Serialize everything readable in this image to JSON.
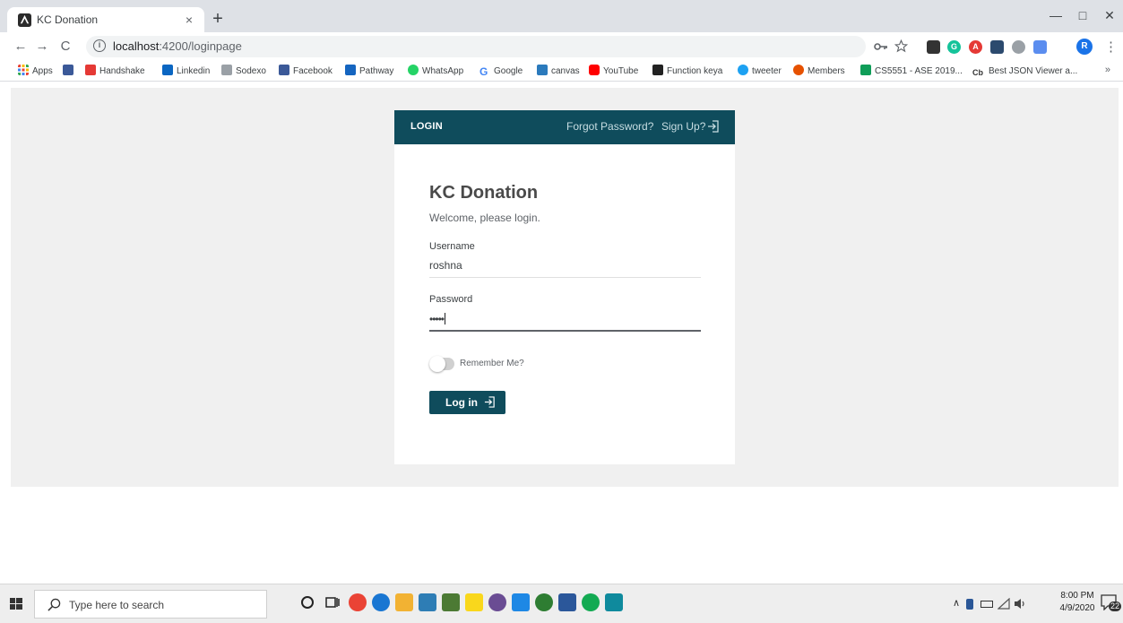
{
  "browser": {
    "tab_title": "KC Donation",
    "tab_close": "×",
    "new_tab": "+",
    "window_controls": {
      "minimize": "—",
      "maximize": "□",
      "close": "✕"
    },
    "nav": {
      "back": "←",
      "forward": "→",
      "reload": "C"
    },
    "url": {
      "host": "localhost",
      "path": ":4200/loginpage"
    },
    "avatar_letter": "R",
    "menu": "⋮"
  },
  "bookmarks": {
    "items": [
      {
        "label": "Apps",
        "color": "#4285f4"
      },
      {
        "label": "",
        "color": "#3b5998"
      },
      {
        "label": "Handshake",
        "color": "#e53935"
      },
      {
        "label": "Linkedin",
        "color": "#0a66c2"
      },
      {
        "label": "Sodexo",
        "color": "#9aa0a6"
      },
      {
        "label": "Facebook",
        "color": "#3b5998"
      },
      {
        "label": "Pathway",
        "color": "#1565c0"
      },
      {
        "label": "WhatsApp",
        "color": "#25d366"
      },
      {
        "label": "Google",
        "color": "#4285f4"
      },
      {
        "label": "canvas",
        "color": "#2b7abc"
      },
      {
        "label": "YouTube",
        "color": "#ff0000"
      },
      {
        "label": "Function keya",
        "color": "#222222"
      },
      {
        "label": "tweeter",
        "color": "#1da1f2"
      },
      {
        "label": "Members",
        "color": "#e65100"
      },
      {
        "label": "CS5551 - ASE 2019...",
        "color": "#0f9d58"
      },
      {
        "label": "Best JSON Viewer a...",
        "color": "#333333"
      }
    ],
    "more": "»"
  },
  "login": {
    "header_title": "LOGIN",
    "forgot_password": "Forgot Password?",
    "sign_up": "Sign Up?",
    "title": "KC Donation",
    "subtitle": "Welcome, please login.",
    "username_label": "Username",
    "username_value": "roshna",
    "password_label": "Password",
    "password_value": "•••••",
    "remember_label": "Remember Me?",
    "login_button": "Log in",
    "accent_color": "#0f4c5c"
  },
  "taskbar": {
    "search_placeholder": "Type here to search",
    "time": "8:00 PM",
    "date": "4/9/2020",
    "notification_count": "22"
  }
}
